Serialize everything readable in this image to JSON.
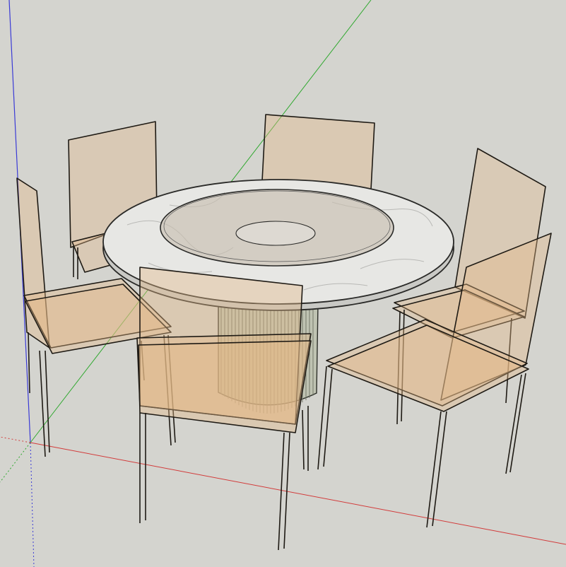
{
  "viewport": {
    "background_color": "#d4d4cf",
    "axis_colors": {
      "x": "#d23b3b",
      "y": "#2fa82f",
      "z": "#3a3ad6"
    }
  },
  "scene": {
    "objects": [
      "round-dining-table",
      "lazy-susan",
      "fluted-pedestal-base",
      "chair-back-center",
      "chair-back-left",
      "chair-left",
      "chair-back-right",
      "chair-front-right",
      "chair-front-center"
    ],
    "table_top_color": "#e7e7e4",
    "marble_vein_color": "#b9b9b6",
    "turntable_color": "#ccc2b4",
    "pedestal_color": "#bfc3b2",
    "chair_tint": "#e4b887"
  }
}
